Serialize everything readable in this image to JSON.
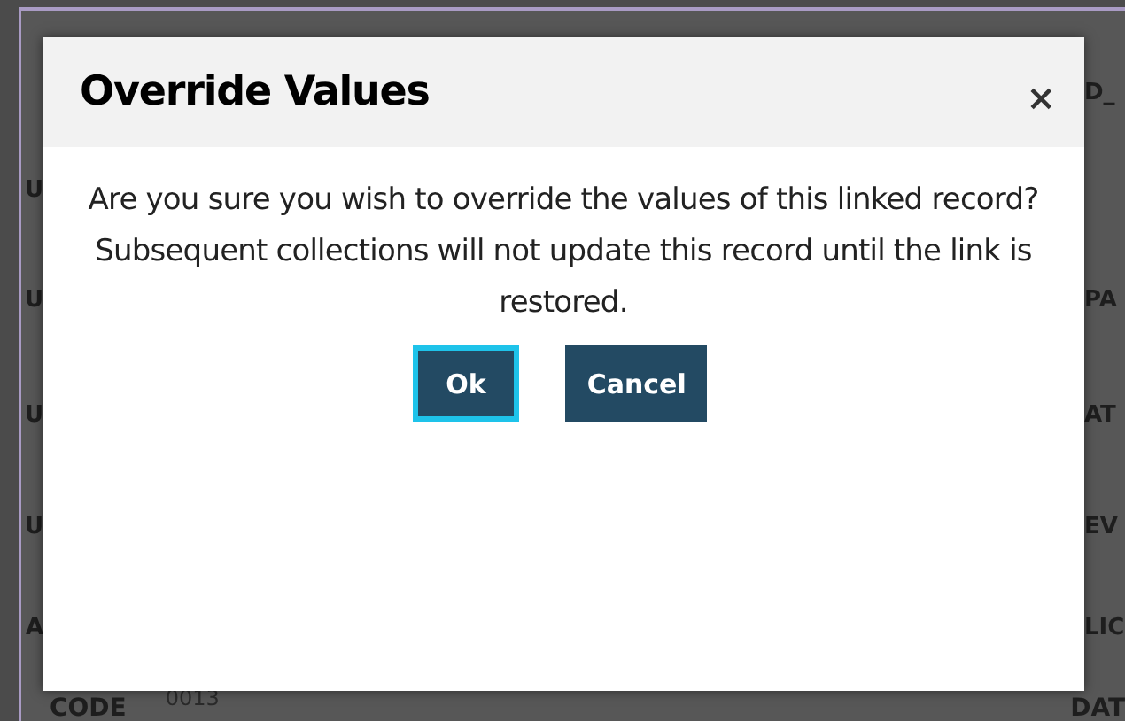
{
  "background": {
    "rows": [
      {
        "right": "D_"
      },
      {
        "left": "U"
      },
      {
        "left": "U",
        "right": "PA"
      },
      {
        "left": "U",
        "right": "AT"
      },
      {
        "left": "U",
        "right": "EV"
      },
      {
        "left": "A",
        "right": "LIC"
      }
    ],
    "footer": {
      "label": "CODE",
      "value": "0013",
      "right": "DAT"
    }
  },
  "dialog": {
    "title": "Override Values",
    "close": "×",
    "message": "Are you sure you wish to override the values of this linked record? Subsequent collections will not update this record until the link is restored.",
    "buttons": [
      {
        "label": "Ok",
        "focused": true
      },
      {
        "label": "Cancel",
        "focused": false
      }
    ]
  }
}
